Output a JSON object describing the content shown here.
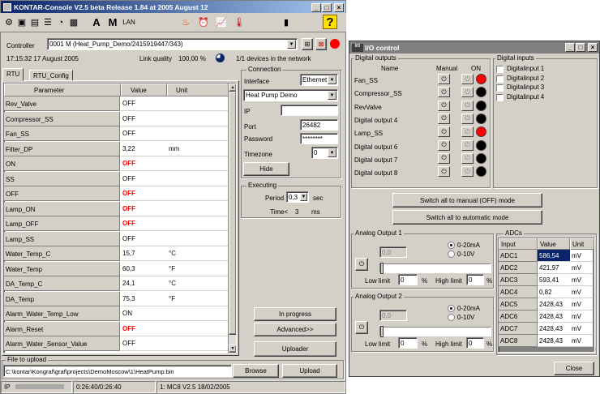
{
  "main_window": {
    "title": "KONTAR-Console V2.5 beta Release 1.84 at 2005 August 12",
    "toolbar_text": {
      "a_label": "A",
      "m_label": "M",
      "lan_label": "LAN"
    },
    "controller_label": "Controller",
    "controller_value": "0001 M (Heat_Pump_Demo/2415919447/343)",
    "timestamp": "17:15:32 17 August 2005",
    "link_quality_label": "Link quality",
    "link_quality_value": "100,00 %",
    "devices_text": "1/1 devices in the network",
    "tabs": [
      "RTU",
      "RTU_Config"
    ],
    "grid_headers": [
      "Parameter",
      "Value",
      "Unit"
    ],
    "grid_rows": [
      {
        "p": "Rev_Valve",
        "v": "OFF",
        "u": ""
      },
      {
        "p": "Compressor_SS",
        "v": "OFF",
        "u": ""
      },
      {
        "p": "Fan_SS",
        "v": "OFF",
        "u": ""
      },
      {
        "p": "Filter_DP",
        "v": "3,22",
        "u": "mm"
      },
      {
        "p": "ON",
        "v": "OFF",
        "u": ""
      },
      {
        "p": "SS",
        "v": "OFF",
        "u": ""
      },
      {
        "p": "OFF",
        "v": "OFF",
        "u": ""
      },
      {
        "p": "Lamp_ON",
        "v": "OFF",
        "u": ""
      },
      {
        "p": "Lamp_OFF",
        "v": "OFF",
        "u": ""
      },
      {
        "p": "Lamp_SS",
        "v": "OFF",
        "u": ""
      },
      {
        "p": "Water_Temp_C",
        "v": "15,7",
        "u": "°C"
      },
      {
        "p": "Water_Temp",
        "v": "60,3",
        "u": "°F"
      },
      {
        "p": "DA_Temp_C",
        "v": "24,1",
        "u": "°C"
      },
      {
        "p": "DA_Temp",
        "v": "75,3",
        "u": "°F"
      },
      {
        "p": "Alarm_Water_Temp_Low",
        "v": "ON",
        "u": ""
      },
      {
        "p": "Alarm_Reset",
        "v": "OFF",
        "u": ""
      },
      {
        "p": "Alarm_Water_Sensor_Value",
        "v": "OFF",
        "u": ""
      }
    ],
    "connection": {
      "group_label": "Connection",
      "interface_label": "Interface",
      "interface_value": "Ethernet",
      "profile_value": "Heat Pump Demo",
      "ip_label": "IP",
      "ip_value": "",
      "port_label": "Port",
      "port_value": "26482",
      "password_label": "Password",
      "password_value": "********",
      "timezone_label": "Timezone",
      "timezone_value": "0",
      "hide_button": "Hide"
    },
    "executing": {
      "group_label": "Executing",
      "period_label": "Period",
      "period_value": "0,3",
      "period_unit": "sec",
      "time_label": "Time<",
      "time_value": "3",
      "time_unit": "ms"
    },
    "buttons": {
      "in_progress": "In progress",
      "advanced": "Advanced>>",
      "uploader": "Uploader",
      "browse": "Browse",
      "upload": "Upload"
    },
    "file_group_label": "File to upload",
    "file_path": "C:\\kontar\\Kongraf\\graf\\projects\\DemoMoscow\\1\\HeatPump.bin",
    "status": {
      "s1": "IP",
      "s2": "0:26:40/0:26:40",
      "s3": "1: MC8 V2.5 18/02/2005"
    }
  },
  "io_window": {
    "title": "I/O control",
    "title_icon_label": "I/O",
    "digital_outputs_label": "Digital outputs",
    "name_header": "Name",
    "manual_header": "Manual",
    "on_header": "ON",
    "outputs": [
      {
        "name": "Fan_SS",
        "state": "red"
      },
      {
        "name": "Compressor_SS",
        "state": "black"
      },
      {
        "name": "RevValve",
        "state": "black"
      },
      {
        "name": "Digital output 4",
        "state": "black"
      },
      {
        "name": "Lamp_SS",
        "state": "red"
      },
      {
        "name": "Digital output 6",
        "state": "black"
      },
      {
        "name": "Digital output 7",
        "state": "black"
      },
      {
        "name": "Digital output 8",
        "state": "black"
      }
    ],
    "digital_inputs_label": "Digital inputs",
    "inputs": [
      "Digitalinput 1",
      "Digitalinput 2",
      "Digitalinput 3",
      "Digitalinput 4"
    ],
    "switch_manual_button": "Switch all to manual (OFF) mode",
    "switch_auto_button": "Switch all to automatic mode",
    "analog1": {
      "label": "Analog Output 1",
      "value": "0,0",
      "radio1": "0-20mA",
      "radio2": "0-10V",
      "low_label": "Low limit",
      "low_value": "0",
      "pct1": "%",
      "high_label": "High limit",
      "high_value": "0",
      "pct2": "%"
    },
    "analog2": {
      "label": "Analog Output 2",
      "value": "0,0",
      "radio1": "0-20mA",
      "radio2": "0-10V",
      "low_label": "Low limit",
      "low_value": "0",
      "pct1": "%",
      "high_label": "High limit",
      "high_value": "0",
      "pct2": "%"
    },
    "adc_label": "ADCs",
    "adc_headers": [
      "Input",
      "Value",
      "Unit"
    ],
    "adcs": [
      {
        "i": "ADC1",
        "v": "586,54",
        "u": "mV"
      },
      {
        "i": "ADC2",
        "v": "421,97",
        "u": "mV"
      },
      {
        "i": "ADC3",
        "v": "593,41",
        "u": "mV"
      },
      {
        "i": "ADC4",
        "v": "0,82",
        "u": "mV"
      },
      {
        "i": "ADC5",
        "v": "2428,43",
        "u": "mV"
      },
      {
        "i": "ADC6",
        "v": "2428,43",
        "u": "mV"
      },
      {
        "i": "ADC7",
        "v": "2428,43",
        "u": "mV"
      },
      {
        "i": "ADC8",
        "v": "2428,43",
        "u": "mV"
      }
    ],
    "close_button": "Close"
  },
  "colors": {
    "led_red": "#ff0000",
    "led_black": "#000000",
    "selection": "#0a246a"
  }
}
